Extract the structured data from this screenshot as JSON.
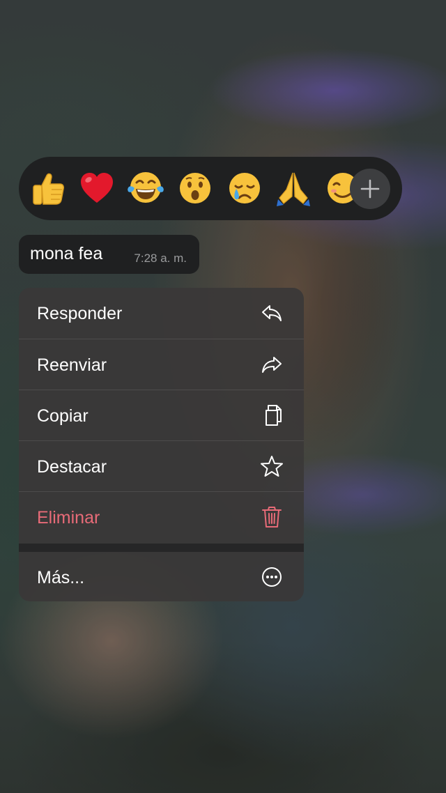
{
  "reactions": {
    "emojis": [
      {
        "name": "thumbs-up",
        "char": "👍"
      },
      {
        "name": "red-heart",
        "char": "❤️"
      },
      {
        "name": "face-with-tears-of-joy",
        "char": "😂"
      },
      {
        "name": "face-with-open-mouth",
        "char": "😮"
      },
      {
        "name": "crying-face",
        "char": "😢"
      },
      {
        "name": "folded-hands",
        "char": "🙏"
      },
      {
        "name": "smiling-face",
        "char": "☺️"
      }
    ],
    "more_icon": "plus-icon"
  },
  "message": {
    "text": "mona fea",
    "time": "7:28 a. m."
  },
  "menu": {
    "items": [
      {
        "label": "Responder",
        "icon": "reply-icon"
      },
      {
        "label": "Reenviar",
        "icon": "forward-icon"
      },
      {
        "label": "Copiar",
        "icon": "copy-icon"
      },
      {
        "label": "Destacar",
        "icon": "star-icon"
      },
      {
        "label": "Eliminar",
        "icon": "trash-icon"
      },
      {
        "label": "Más...",
        "icon": "more-icon"
      }
    ]
  },
  "colors": {
    "danger": "#e86b78",
    "surface": "#1f2021",
    "menu": "#3a3838",
    "text": "#ffffff",
    "muted": "#9a9b9d"
  }
}
